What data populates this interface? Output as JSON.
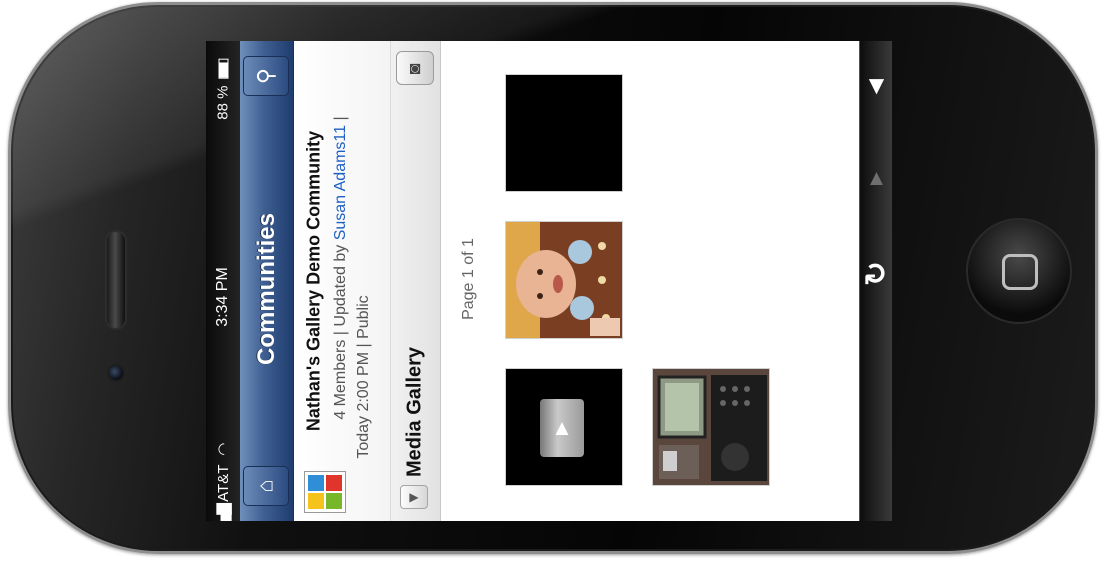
{
  "status_bar": {
    "carrier": "AT&T",
    "time": "3:34 PM",
    "battery": "88 %"
  },
  "nav": {
    "title": "Communities",
    "home_icon": "home-icon",
    "search_icon": "search-icon"
  },
  "community": {
    "name": "Nathan's Gallery Demo Community",
    "meta_prefix": "4 Members | Updated by",
    "updated_by": "Susan Adams11",
    "meta_suffix": "|",
    "meta_line2": "Today 2:00 PM | Public"
  },
  "section": {
    "title": "Media Gallery",
    "camera_icon": "camera-icon",
    "disclosure_icon": "disclosure-triangle-icon"
  },
  "pager": {
    "label": "Page 1 of 1"
  },
  "gallery": {
    "items": [
      {
        "kind": "video",
        "icon": "play-icon"
      },
      {
        "kind": "photo",
        "subject": "baby"
      },
      {
        "kind": "blank"
      },
      {
        "kind": "photo",
        "subject": "desk phone"
      }
    ]
  },
  "toolbar": {
    "refresh_icon": "refresh-icon",
    "up_icon": "up-arrow-icon",
    "down_icon": "down-arrow-icon",
    "up_enabled": false,
    "down_enabled": true
  },
  "colors": {
    "nav_blue": "#2c4b80",
    "link_blue": "#1d5fc4"
  }
}
